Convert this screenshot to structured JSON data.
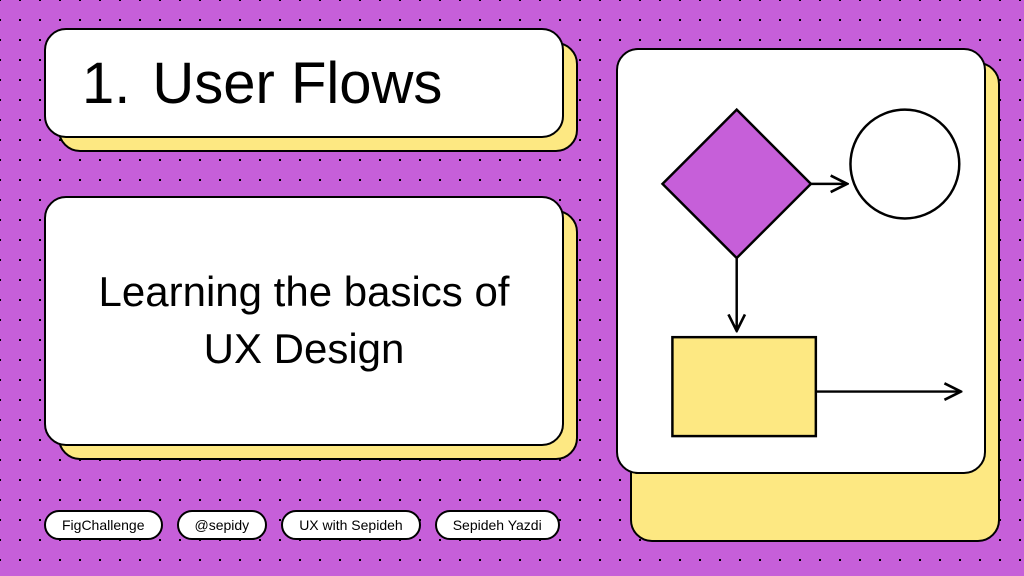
{
  "title": {
    "number": "1.",
    "text": "User Flows"
  },
  "subtitle": "Learning the basics of UX Design",
  "tags": [
    "FigChallenge",
    "@sepidy",
    "UX with Sepideh",
    "Sepideh Yazdi"
  ],
  "diagram": {
    "shapes": {
      "diamond": {
        "fill": "#c65fd9"
      },
      "circle": {
        "fill": "#ffffff"
      },
      "rect": {
        "fill": "#fde882"
      }
    }
  },
  "colors": {
    "bg": "#c65fd9",
    "accent": "#fde882"
  }
}
